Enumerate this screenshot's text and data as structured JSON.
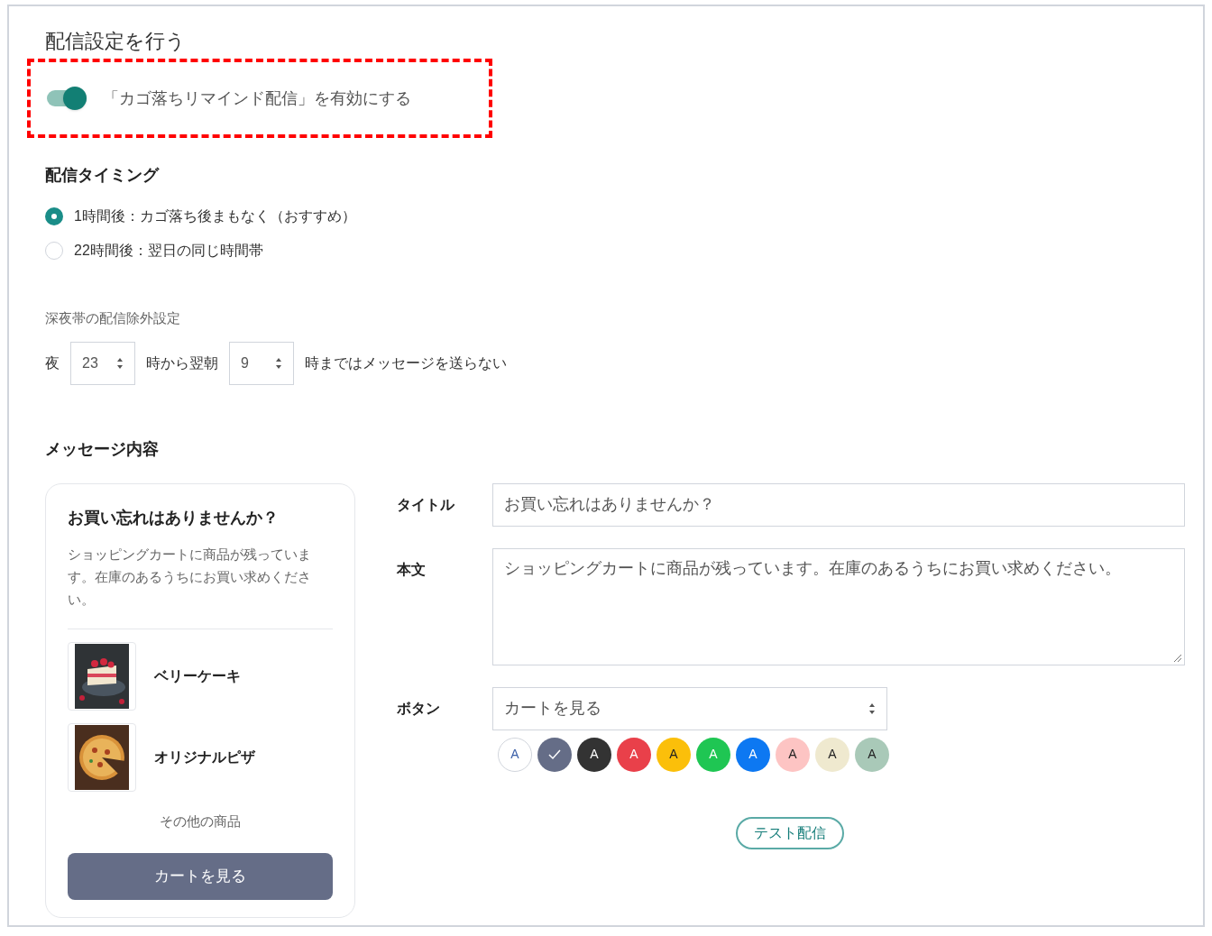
{
  "heading": "配信設定を行う",
  "toggle": {
    "label": "「カゴ落ちリマインド配信」を有効にする",
    "on": true
  },
  "timing": {
    "title": "配信タイミング",
    "options": [
      {
        "label": "1時間後：カゴ落ち後まもなく（おすすめ）",
        "selected": true
      },
      {
        "label": "22時間後：翌日の同じ時間帯",
        "selected": false
      }
    ]
  },
  "quiet_hours": {
    "title": "深夜帯の配信除外設定",
    "prefix": "夜",
    "from": "23",
    "middle": "時から翌朝",
    "to": "9",
    "suffix": "時まではメッセージを送らない"
  },
  "message": {
    "title": "メッセージ内容",
    "preview": {
      "title": "お買い忘れはありませんか？",
      "body": "ショッピングカートに商品が残っています。在庫のあるうちにお買い求めください。",
      "items": [
        {
          "name": "ベリーケーキ",
          "kind": "cake"
        },
        {
          "name": "オリジナルピザ",
          "kind": "pizza"
        }
      ],
      "more": "その他の商品",
      "button": "カートを見る"
    },
    "fields": {
      "title_label": "タイトル",
      "title_value": "お買い忘れはありませんか？",
      "body_label": "本文",
      "body_value": "ショッピングカートに商品が残っています。在庫のあるうちにお買い求めください。",
      "button_label": "ボタン",
      "button_value": "カートを見る"
    },
    "swatches": [
      {
        "label": "A",
        "color": "#ffffff",
        "selected": false
      },
      {
        "color": "#656d87",
        "selected": true
      },
      {
        "label": "A",
        "color": "#333333",
        "selected": false
      },
      {
        "label": "A",
        "color": "#e9404a",
        "selected": false
      },
      {
        "label": "A",
        "color": "#fbbf0a",
        "selected": false
      },
      {
        "label": "A",
        "color": "#1fc653",
        "selected": false
      },
      {
        "label": "A",
        "color": "#0d78f2",
        "selected": false
      },
      {
        "label": "A",
        "color": "#fdc4c3",
        "selected": false
      },
      {
        "label": "A",
        "color": "#efe9cf",
        "selected": false
      },
      {
        "label": "A",
        "color": "#a9c9b8",
        "selected": false
      }
    ],
    "test_button": "テスト配信"
  }
}
